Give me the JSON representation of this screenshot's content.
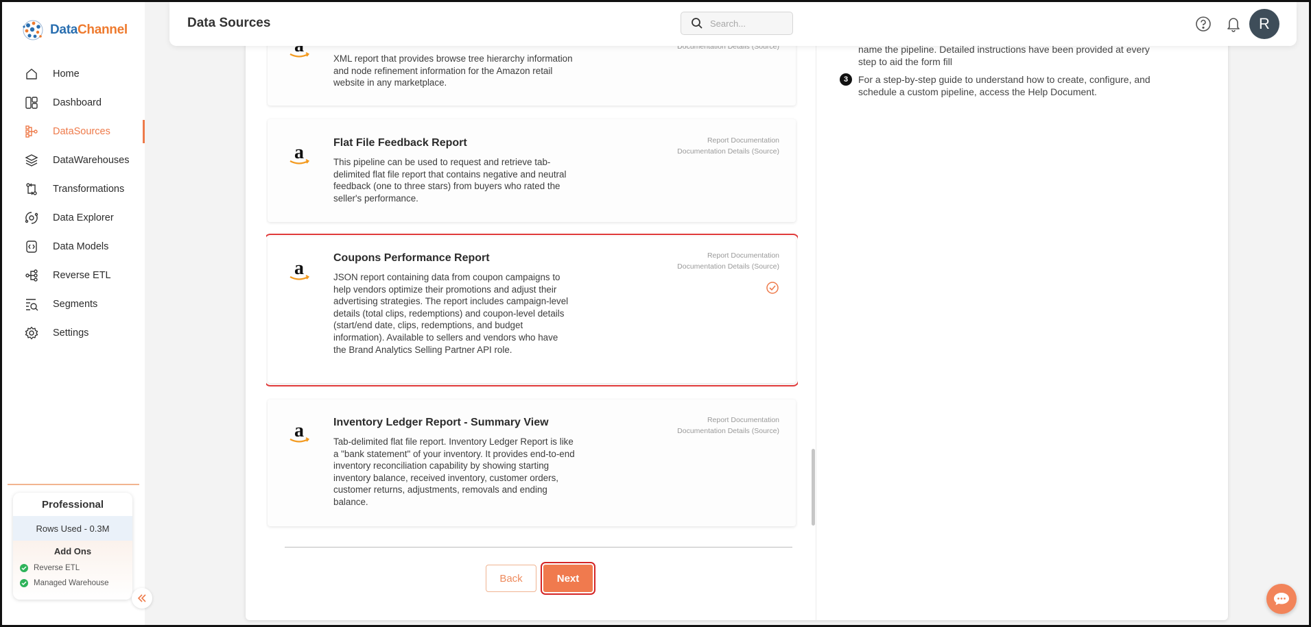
{
  "app": {
    "logo_part1": "Data",
    "logo_part2": "Channel",
    "brand_color": "#ee7a2e",
    "accent_color": "#ee7a4a"
  },
  "header": {
    "title": "Data Sources",
    "search_placeholder": "Search...",
    "avatar_initial": "R"
  },
  "sidebar": {
    "items": [
      {
        "label": "Home",
        "icon": "home-icon",
        "active": false
      },
      {
        "label": "Dashboard",
        "icon": "dashboard-icon",
        "active": false
      },
      {
        "label": "DataSources",
        "icon": "datasources-icon",
        "active": true
      },
      {
        "label": "DataWarehouses",
        "icon": "datawarehouses-icon",
        "active": false
      },
      {
        "label": "Transformations",
        "icon": "transformations-icon",
        "active": false
      },
      {
        "label": "Data Explorer",
        "icon": "data-explorer-icon",
        "active": false
      },
      {
        "label": "Data Models",
        "icon": "data-models-icon",
        "active": false
      },
      {
        "label": "Reverse ETL",
        "icon": "reverse-etl-icon",
        "active": false
      },
      {
        "label": "Segments",
        "icon": "segments-icon",
        "active": false
      },
      {
        "label": "Settings",
        "icon": "settings-icon",
        "active": false
      }
    ],
    "plan": {
      "name": "Professional",
      "rows_used": "Rows Used - 0.3M",
      "addons_title": "Add Ons",
      "addons": [
        "Reverse ETL",
        "Managed Warehouse"
      ]
    }
  },
  "instructions": {
    "step2_tail": "name the pipeline. Detailed instructions have been provided at every step to aid the form fill",
    "step3_number": "3",
    "step3_text": "For a step-by-step guide to understand how to create, configure, and schedule a custom pipeline, access the Help Document."
  },
  "reports": [
    {
      "title": "",
      "description": "XML report that provides browse tree hierarchy information and node refinement information for the Amazon retail website in any marketplace.",
      "link1": "",
      "link2": "Documentation Details (Source)",
      "selected": false
    },
    {
      "title": "Flat File Feedback Report",
      "description": "This pipeline can be used to request and retrieve tab-delimited flat file report that contains negative and neutral feedback (one to three stars) from buyers who rated the seller's performance.",
      "link1": "Report Documentation",
      "link2": "Documentation Details (Source)",
      "selected": false
    },
    {
      "title": "Coupons Performance Report",
      "description": "JSON report containing data from coupon campaigns to help vendors optimize their promotions and adjust their advertising strategies. The report includes campaign-level details (total clips, redemptions) and coupon-level details (start/end date, clips, redemptions, and budget information). Available to sellers and vendors who have the Brand Analytics Selling Partner API role.",
      "link1": "Report Documentation",
      "link2": "Documentation Details (Source)",
      "selected": true
    },
    {
      "title": "Inventory Ledger Report - Summary View",
      "description": "Tab-delimited flat file report. Inventory Ledger Report is like a \"bank statement\" of your inventory. It provides end-to-end inventory reconciliation capability by showing starting inventory balance, received inventory, customer orders, customer returns, adjustments, removals and ending balance.",
      "link1": "Report Documentation",
      "link2": "Documentation Details (Source)",
      "selected": false
    }
  ],
  "footer": {
    "back_label": "Back",
    "next_label": "Next"
  }
}
